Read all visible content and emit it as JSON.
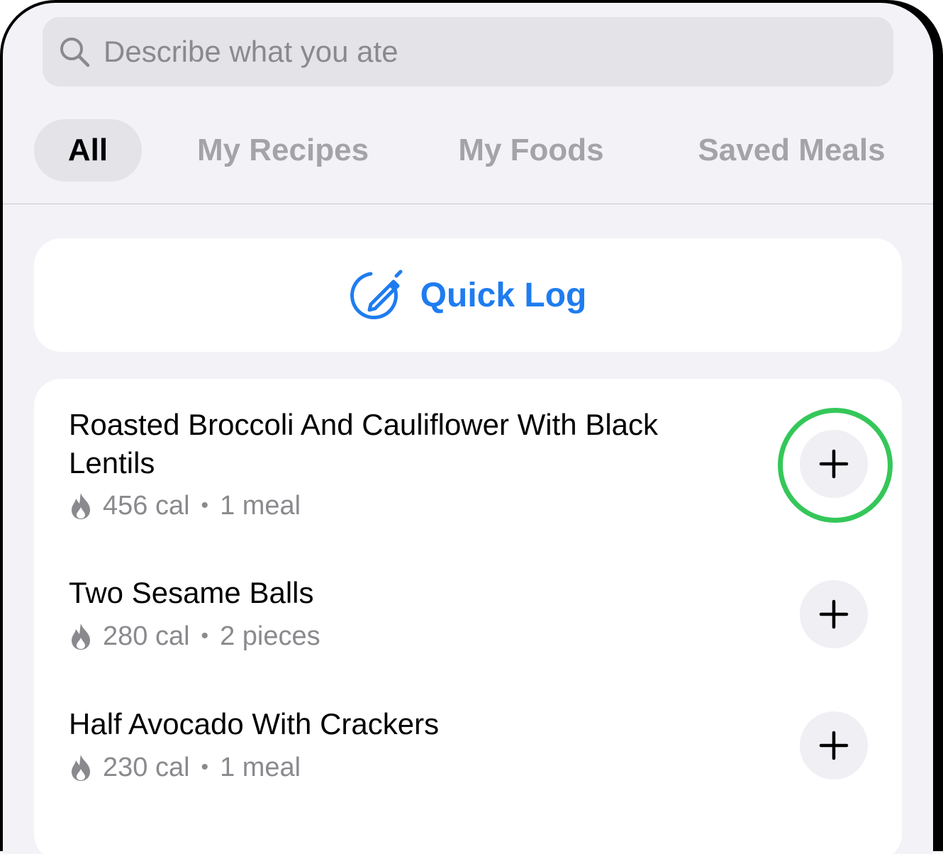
{
  "search": {
    "placeholder": "Describe what you ate",
    "value": ""
  },
  "tabs": [
    {
      "label": "All",
      "active": true
    },
    {
      "label": "My Recipes",
      "active": false
    },
    {
      "label": "My Foods",
      "active": false
    },
    {
      "label": "Saved Meals",
      "active": false
    }
  ],
  "quick_log": {
    "label": "Quick Log"
  },
  "foods": [
    {
      "name": "Roasted Broccoli And Cauliflower With Black Lentils",
      "calories": "456 cal",
      "separator": "•",
      "portion": "1 meal",
      "highlighted": true
    },
    {
      "name": "Two Sesame Balls",
      "calories": "280 cal",
      "separator": "•",
      "portion": "2 pieces",
      "highlighted": false
    },
    {
      "name": "Half Avocado With Crackers",
      "calories": "230 cal",
      "separator": "•",
      "portion": "1 meal",
      "highlighted": false
    }
  ],
  "icons": {
    "search": "search-icon",
    "quick_log": "pencil-circle-icon",
    "calories": "flame-icon",
    "add": "plus-icon"
  },
  "colors": {
    "accent": "#1f7cf0",
    "highlight": "#34c759",
    "background": "#f2f2f7",
    "secondary_text": "#8a8a8e"
  }
}
